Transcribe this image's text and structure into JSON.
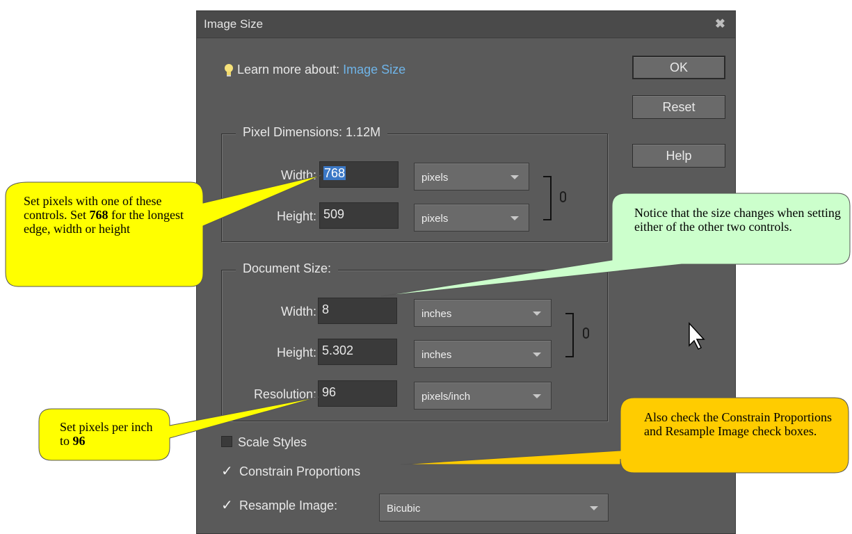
{
  "dialog": {
    "title": "Image Size",
    "close_glyph": "✖",
    "learn_prefix": "Learn more about:",
    "learn_link": "Image Size",
    "buttons": {
      "ok": "OK",
      "reset": "Reset",
      "help": "Help"
    },
    "pixel_dimensions": {
      "legend": "Pixel Dimensions:  1.12M",
      "width_label": "Width:",
      "width_value": "768",
      "width_unit": "pixels",
      "height_label": "Height:",
      "height_value": "509",
      "height_unit": "pixels"
    },
    "document_size": {
      "legend": "Document Size:",
      "width_label": "Width:",
      "width_value": "8",
      "width_unit": "inches",
      "height_label": "Height:",
      "height_value": "5.302",
      "height_unit": "inches",
      "resolution_label": "Resolution:",
      "resolution_value": "96",
      "resolution_unit": "pixels/inch"
    },
    "checkboxes": {
      "scale_styles": {
        "label": "Scale Styles",
        "checked": false
      },
      "constrain_proportions": {
        "label": "Constrain Proportions",
        "checked": true
      },
      "resample_image": {
        "label": "Resample Image:",
        "checked": true
      }
    },
    "resample_method": "Bicubic",
    "check_glyph": "✓"
  },
  "callouts": {
    "pixels_a": "Set pixels with one of these controls. Set ",
    "pixels_b": "768",
    "pixels_c": " for the longest edge, width or height",
    "notice": "Notice that the size changes when setting either of the other two controls.",
    "ppi_a": "Set pixels per inch to ",
    "ppi_b": "96",
    "check": "Also check the Constrain Proportions and Resample Image check boxes."
  },
  "colors": {
    "dialog_bg": "#5a5a5a",
    "link": "#6fb4e8",
    "selection": "#3b78c6",
    "callout_yellow": "#ffff00",
    "callout_green": "#ccffcc",
    "callout_orange": "#ffcc00"
  }
}
